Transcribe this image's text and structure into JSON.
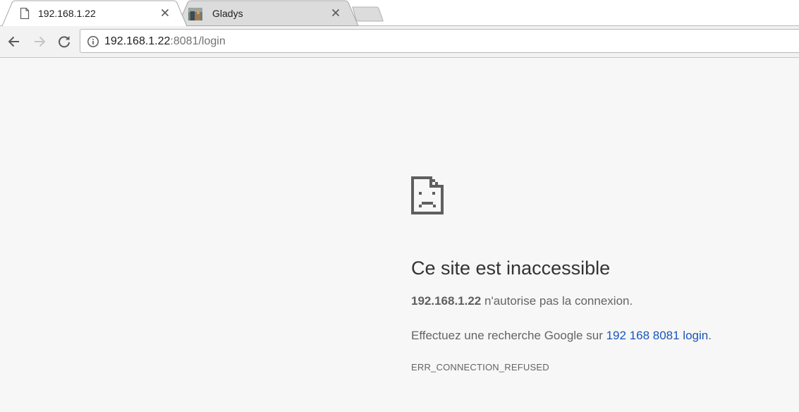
{
  "tabs": [
    {
      "title": "192.168.1.22",
      "active": true,
      "favicon": "page-icon"
    },
    {
      "title": "Gladys",
      "active": false,
      "favicon": "gladys-favicon"
    }
  ],
  "omnibox": {
    "url_host": "192.168.1.22",
    "url_rest": ":8081/login",
    "security_icon": "info-icon"
  },
  "error_page": {
    "icon": "sad-page-icon",
    "title": "Ce site est inaccessible",
    "host_bold": "192.168.1.22",
    "description_rest": " n'autorise pas la connexion.",
    "suggestion_prefix": "Effectuez une recherche Google sur ",
    "suggestion_link": "192 168 8081 login",
    "suggestion_suffix": ".",
    "error_code": "ERR_CONNECTION_REFUSED"
  },
  "colors": {
    "page_background": "#f7f7f7",
    "link": "#1a55b8",
    "toolbar": "#f2f2f2",
    "inactive_tab": "#dcdcdc"
  }
}
